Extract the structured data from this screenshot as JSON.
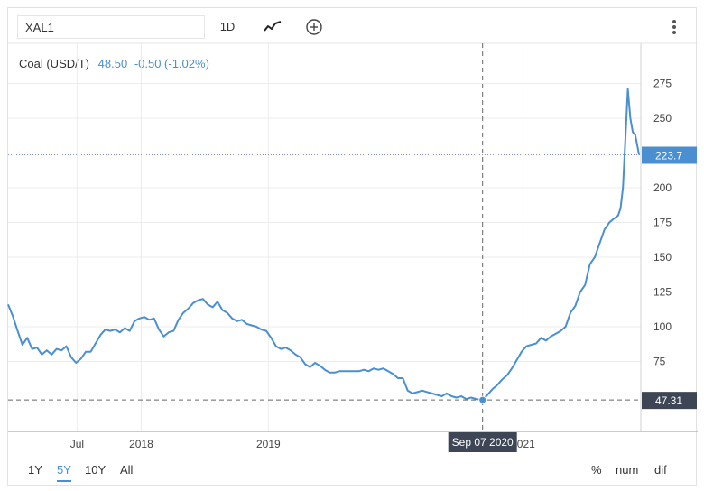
{
  "toolbar": {
    "symbol_value": "XAL1",
    "interval_label": "1D",
    "line_icon": "line-chart-icon",
    "add_icon": "plus-circle-icon",
    "menu_icon": "kebab-menu-icon"
  },
  "legend": {
    "name": "Coal (USD/T)",
    "value": "48.50",
    "change": "-0.50 (-1.02%)"
  },
  "ranges": [
    "1Y",
    "5Y",
    "10Y",
    "All"
  ],
  "active_range": "5Y",
  "modes": [
    "%",
    "num",
    "dif"
  ],
  "colors": {
    "line": "#4a8fd0",
    "price_box": "#4a8fd0",
    "crosshair_box": "#3e4656",
    "grid": "#ececec"
  },
  "chart_data": {
    "type": "line",
    "title": "",
    "xlabel": "",
    "ylabel": "",
    "ylim": [
      25,
      285
    ],
    "y_ticks": [
      75,
      100,
      125,
      150,
      175,
      200,
      250,
      275
    ],
    "x_ticks": [
      {
        "label": "Jul",
        "date": "2017-07-01"
      },
      {
        "label": "2018",
        "date": "2018-01-01"
      },
      {
        "label": "2019",
        "date": "2019-01-01"
      },
      {
        "label": "2021",
        "date": "2021-01-01"
      }
    ],
    "last_price_label": "223.7",
    "last_price": 223.7,
    "crosshair": {
      "date_label": "Sep 07 2020",
      "date": "2020-09-07",
      "value_label": "47.31",
      "value": 47.31
    },
    "series": [
      {
        "points": [
          [
            "2016-12-15",
            116
          ],
          [
            "2016-12-28",
            108
          ],
          [
            "2017-01-10",
            98
          ],
          [
            "2017-01-25",
            87
          ],
          [
            "2017-02-08",
            92
          ],
          [
            "2017-02-22",
            84
          ],
          [
            "2017-03-08",
            85
          ],
          [
            "2017-03-22",
            80
          ],
          [
            "2017-04-05",
            83
          ],
          [
            "2017-04-19",
            80
          ],
          [
            "2017-05-03",
            84
          ],
          [
            "2017-05-17",
            83
          ],
          [
            "2017-05-31",
            86
          ],
          [
            "2017-06-14",
            78
          ],
          [
            "2017-06-28",
            74
          ],
          [
            "2017-07-12",
            77
          ],
          [
            "2017-07-26",
            82
          ],
          [
            "2017-08-09",
            82
          ],
          [
            "2017-08-23",
            88
          ],
          [
            "2017-09-06",
            94
          ],
          [
            "2017-09-20",
            98
          ],
          [
            "2017-10-04",
            97
          ],
          [
            "2017-10-18",
            98
          ],
          [
            "2017-11-01",
            96
          ],
          [
            "2017-11-15",
            99
          ],
          [
            "2017-11-29",
            97
          ],
          [
            "2017-12-13",
            104
          ],
          [
            "2017-12-27",
            106
          ],
          [
            "2018-01-10",
            107
          ],
          [
            "2018-01-24",
            105
          ],
          [
            "2018-02-07",
            106
          ],
          [
            "2018-02-21",
            98
          ],
          [
            "2018-03-07",
            93
          ],
          [
            "2018-03-21",
            96
          ],
          [
            "2018-04-04",
            97
          ],
          [
            "2018-04-18",
            105
          ],
          [
            "2018-05-02",
            110
          ],
          [
            "2018-05-16",
            113
          ],
          [
            "2018-05-30",
            117
          ],
          [
            "2018-06-13",
            119
          ],
          [
            "2018-06-27",
            120
          ],
          [
            "2018-07-11",
            116
          ],
          [
            "2018-07-25",
            114
          ],
          [
            "2018-08-08",
            118
          ],
          [
            "2018-08-22",
            112
          ],
          [
            "2018-09-05",
            110
          ],
          [
            "2018-09-19",
            106
          ],
          [
            "2018-10-03",
            104
          ],
          [
            "2018-10-17",
            105
          ],
          [
            "2018-10-31",
            102
          ],
          [
            "2018-11-14",
            101
          ],
          [
            "2018-11-28",
            100
          ],
          [
            "2018-12-12",
            98
          ],
          [
            "2018-12-26",
            97
          ],
          [
            "2019-01-09",
            92
          ],
          [
            "2019-01-23",
            86
          ],
          [
            "2019-02-06",
            84
          ],
          [
            "2019-02-20",
            85
          ],
          [
            "2019-03-06",
            83
          ],
          [
            "2019-03-20",
            80
          ],
          [
            "2019-04-03",
            78
          ],
          [
            "2019-04-17",
            73
          ],
          [
            "2019-05-01",
            71
          ],
          [
            "2019-05-15",
            74
          ],
          [
            "2019-05-29",
            72
          ],
          [
            "2019-06-12",
            69
          ],
          [
            "2019-06-26",
            67
          ],
          [
            "2019-07-10",
            67
          ],
          [
            "2019-07-24",
            68
          ],
          [
            "2019-08-07",
            68
          ],
          [
            "2019-08-21",
            68
          ],
          [
            "2019-09-04",
            68
          ],
          [
            "2019-09-18",
            68
          ],
          [
            "2019-10-02",
            69
          ],
          [
            "2019-10-16",
            68
          ],
          [
            "2019-10-30",
            70
          ],
          [
            "2019-11-13",
            69
          ],
          [
            "2019-11-27",
            70
          ],
          [
            "2019-12-11",
            68
          ],
          [
            "2019-12-25",
            66
          ],
          [
            "2020-01-08",
            63
          ],
          [
            "2020-01-22",
            63
          ],
          [
            "2020-02-05",
            54
          ],
          [
            "2020-02-19",
            52
          ],
          [
            "2020-03-04",
            53
          ],
          [
            "2020-03-18",
            54
          ],
          [
            "2020-04-01",
            53
          ],
          [
            "2020-04-15",
            52
          ],
          [
            "2020-04-29",
            51
          ],
          [
            "2020-05-13",
            50
          ],
          [
            "2020-05-27",
            52
          ],
          [
            "2020-06-10",
            50
          ],
          [
            "2020-06-24",
            49
          ],
          [
            "2020-07-08",
            50
          ],
          [
            "2020-07-22",
            48
          ],
          [
            "2020-08-05",
            49
          ],
          [
            "2020-08-19",
            48
          ],
          [
            "2020-09-07",
            47.31
          ],
          [
            "2020-09-21",
            51
          ],
          [
            "2020-10-05",
            55
          ],
          [
            "2020-10-19",
            58
          ],
          [
            "2020-11-02",
            62
          ],
          [
            "2020-11-16",
            65
          ],
          [
            "2020-11-30",
            70
          ],
          [
            "2020-12-14",
            76
          ],
          [
            "2020-12-28",
            82
          ],
          [
            "2021-01-11",
            86
          ],
          [
            "2021-01-25",
            87
          ],
          [
            "2021-02-08",
            88
          ],
          [
            "2021-02-22",
            92
          ],
          [
            "2021-03-08",
            90
          ],
          [
            "2021-03-22",
            93
          ],
          [
            "2021-04-05",
            95
          ],
          [
            "2021-04-19",
            97
          ],
          [
            "2021-05-03",
            100
          ],
          [
            "2021-05-17",
            110
          ],
          [
            "2021-05-31",
            115
          ],
          [
            "2021-06-14",
            125
          ],
          [
            "2021-06-28",
            130
          ],
          [
            "2021-07-12",
            145
          ],
          [
            "2021-07-26",
            150
          ],
          [
            "2021-08-09",
            160
          ],
          [
            "2021-08-23",
            170
          ],
          [
            "2021-09-06",
            175
          ],
          [
            "2021-09-20",
            178
          ],
          [
            "2021-10-01",
            180
          ],
          [
            "2021-10-08",
            185
          ],
          [
            "2021-10-15",
            200
          ],
          [
            "2021-10-22",
            235
          ],
          [
            "2021-10-29",
            271
          ],
          [
            "2021-11-05",
            250
          ],
          [
            "2021-11-12",
            240
          ],
          [
            "2021-11-19",
            238
          ],
          [
            "2021-11-26",
            229
          ],
          [
            "2021-11-30",
            223.7
          ]
        ]
      }
    ]
  }
}
